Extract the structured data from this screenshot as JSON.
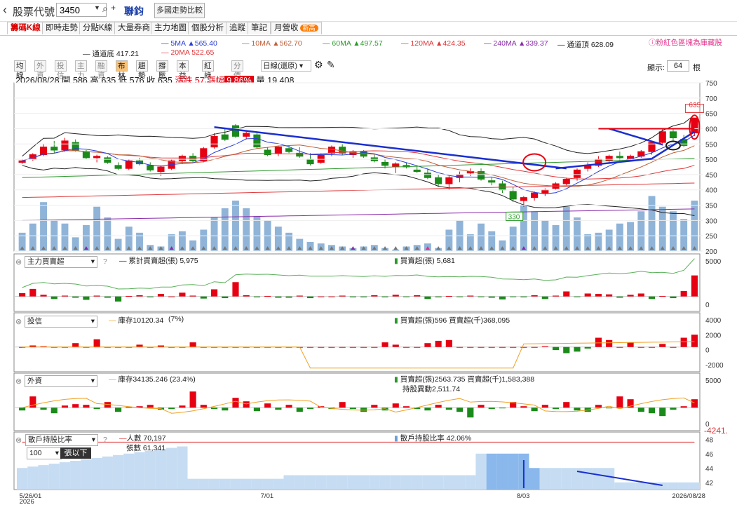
{
  "topbar": {
    "title": "股票代號",
    "stock_code": "3450",
    "stock_name": "聯鈞",
    "compare_label": "多國走勢比較"
  },
  "tabs": [
    {
      "label": "籌碼K線"
    },
    {
      "label": "即時走勢"
    },
    {
      "label": "分點K線"
    },
    {
      "label": "大量券商"
    },
    {
      "label": "主力地圖"
    },
    {
      "label": "個股分析"
    },
    {
      "label": "追蹤"
    },
    {
      "label": "筆記"
    },
    {
      "label": "月營收"
    }
  ],
  "tab_badge": "新高",
  "ma_legend": {
    "ma5": "5MA ▲565.40",
    "ma10": "10MA ▲562.70",
    "ma60": "60MA ▲497.57",
    "ma120": "120MA ▲424.35",
    "ma240": "240MA ▲339.37",
    "upper": "通道頂 628.09",
    "lower": "通道底 417.21",
    "ma20": "20MA 522.65",
    "note": "ⓘ粉紅色區塊為庫藏股"
  },
  "toolbar": {
    "buttons": [
      "均線",
      "外資",
      "投信",
      "主力",
      "融資",
      "布林",
      "趨勢",
      "撐壓",
      "本益比",
      "紅綠燈",
      "分價量"
    ],
    "period": "日線(還原)",
    "display_label": "顯示:",
    "display_count": "64",
    "display_unit": "根"
  },
  "ohlc": {
    "date": "2026/08/28",
    "open": "開 586",
    "high": "高 635",
    "low": "低 576",
    "close": "收 635",
    "change": "漲跌 57",
    "pct_label": "漲幅",
    "pct": "9.86%",
    "volume": "量 19,408"
  },
  "panels": {
    "p1_select": "主力買賣超",
    "p1_cum": "累計買賣超(張) 5,975",
    "p1_net": "買賣超(張) 5,681",
    "p2_select": "投信",
    "p2_inv": "庫存10120.34",
    "p2_pct": "(7%)",
    "p2_net": "買賣超(張)596 買賣超(千)368,095",
    "p3_select": "外資",
    "p3_inv": "庫存34135.246 (23.4%)",
    "p3_net": "買賣超(張)2563.735 買賣超(千)1,583,388",
    "p3_hold": "持股異動2,511.74",
    "p4_select": "散戶持股比率",
    "p4_sub_select": "100",
    "p4_sub_label": "張以下",
    "p4_people": "人數 70,197",
    "p4_shares": "張數 61,341",
    "p4_ratio": "散戶持股比率 42.06%",
    "side_value": "-4241."
  },
  "question_mark": "?",
  "chart_data": {
    "type": "candlestick",
    "price_axis": {
      "ylim": [
        200,
        750
      ],
      "ticks": [
        200,
        250,
        300,
        350,
        400,
        450,
        500,
        550,
        600,
        650,
        700,
        750
      ]
    },
    "candles": [
      [
        490,
        500,
        485,
        495
      ],
      [
        500,
        520,
        495,
        515
      ],
      [
        515,
        550,
        510,
        540
      ],
      [
        540,
        560,
        520,
        530
      ],
      [
        530,
        570,
        525,
        560
      ],
      [
        555,
        565,
        525,
        530
      ],
      [
        525,
        530,
        500,
        505
      ],
      [
        505,
        515,
        490,
        510
      ],
      [
        505,
        510,
        485,
        490
      ],
      [
        480,
        490,
        465,
        470
      ],
      [
        470,
        500,
        465,
        495
      ],
      [
        495,
        505,
        480,
        485
      ],
      [
        480,
        490,
        460,
        465
      ],
      [
        460,
        480,
        445,
        475
      ],
      [
        470,
        500,
        465,
        495
      ],
      [
        495,
        515,
        485,
        510
      ],
      [
        510,
        520,
        490,
        495
      ],
      [
        495,
        540,
        490,
        535
      ],
      [
        540,
        585,
        535,
        575
      ],
      [
        580,
        600,
        560,
        565
      ],
      [
        610,
        615,
        570,
        575
      ],
      [
        575,
        590,
        565,
        585
      ],
      [
        580,
        590,
        535,
        540
      ],
      [
        530,
        540,
        510,
        515
      ],
      [
        520,
        545,
        510,
        540
      ],
      [
        535,
        545,
        520,
        525
      ],
      [
        520,
        540,
        505,
        510
      ],
      [
        500,
        520,
        480,
        485
      ],
      [
        490,
        520,
        485,
        515
      ],
      [
        520,
        545,
        510,
        540
      ],
      [
        540,
        550,
        515,
        520
      ],
      [
        515,
        530,
        505,
        525
      ],
      [
        525,
        530,
        505,
        510
      ],
      [
        505,
        515,
        490,
        495
      ],
      [
        490,
        500,
        470,
        480
      ],
      [
        475,
        490,
        455,
        485
      ],
      [
        480,
        490,
        470,
        475
      ],
      [
        465,
        480,
        455,
        460
      ],
      [
        455,
        470,
        435,
        440
      ],
      [
        440,
        450,
        410,
        420
      ],
      [
        420,
        445,
        400,
        440
      ],
      [
        440,
        460,
        425,
        450
      ],
      [
        455,
        470,
        445,
        460
      ],
      [
        460,
        470,
        430,
        435
      ],
      [
        430,
        440,
        415,
        425
      ],
      [
        420,
        430,
        390,
        400
      ],
      [
        395,
        410,
        360,
        370
      ],
      [
        365,
        380,
        345,
        375
      ],
      [
        375,
        395,
        365,
        390
      ],
      [
        390,
        405,
        380,
        400
      ],
      [
        405,
        425,
        400,
        420
      ],
      [
        420,
        440,
        415,
        435
      ],
      [
        440,
        470,
        430,
        465
      ],
      [
        470,
        490,
        460,
        480
      ],
      [
        480,
        510,
        475,
        500
      ],
      [
        495,
        515,
        490,
        510
      ],
      [
        510,
        525,
        495,
        505
      ],
      [
        500,
        515,
        495,
        510
      ],
      [
        510,
        530,
        505,
        525
      ],
      [
        525,
        560,
        515,
        555
      ],
      [
        555,
        600,
        545,
        590
      ],
      [
        590,
        600,
        560,
        570
      ],
      [
        565,
        580,
        540,
        545
      ],
      [
        586,
        635,
        576,
        635
      ]
    ],
    "volume": [
      260,
      290,
      360,
      300,
      290,
      245,
      285,
      345,
      310,
      240,
      280,
      260,
      220,
      215,
      255,
      265,
      235,
      270,
      310,
      340,
      365,
      340,
      315,
      300,
      280,
      260,
      240,
      230,
      225,
      220,
      215,
      210,
      215,
      220,
      210,
      205,
      215,
      220,
      225,
      210,
      270,
      300,
      255,
      290,
      265,
      235,
      280,
      350,
      330,
      300,
      285,
      345,
      310,
      255,
      260,
      270,
      290,
      295,
      330,
      380,
      345,
      330,
      305,
      365
    ],
    "annotations": [
      {
        "label": "635"
      },
      {
        "label": "330"
      }
    ],
    "x_ticks": [
      {
        "label": "5/26/01"
      },
      {
        "label": "2026"
      },
      {
        "label": "7/01"
      },
      {
        "label": "8/03"
      },
      {
        "label": "2026/08/28"
      }
    ],
    "panel1": {
      "ticks": [
        "5000",
        "0"
      ],
      "values": [
        80,
        180,
        40,
        -60,
        20,
        -30,
        -80,
        20,
        -30,
        -120,
        10,
        30,
        -20,
        60,
        0,
        90,
        20,
        -50,
        170,
        -40,
        340,
        30,
        -20,
        10,
        -30,
        -30,
        20,
        -40,
        0,
        0,
        20,
        -20,
        -20,
        30,
        -20,
        40,
        -10,
        30,
        -60,
        -20,
        10,
        -10,
        20,
        -10,
        -30,
        -70,
        -10,
        -20,
        30,
        -60,
        20,
        120,
        -10,
        70,
        60,
        50,
        -30,
        40,
        70,
        -60,
        10,
        -40,
        130,
        500
      ]
    },
    "panel2": {
      "ticks": [
        "4000",
        "2000",
        "0",
        "-2000"
      ],
      "values": [
        0,
        20,
        10,
        0,
        0,
        50,
        0,
        100,
        0,
        0,
        0,
        30,
        0,
        20,
        0,
        0,
        60,
        0,
        0,
        0,
        0,
        0,
        0,
        0,
        0,
        0,
        0,
        0,
        0,
        0,
        0,
        0,
        0,
        0,
        60,
        30,
        0,
        0,
        50,
        80,
        90,
        0,
        0,
        0,
        0,
        0,
        0,
        0,
        0,
        10,
        -40,
        -80,
        -60,
        -20,
        120,
        90,
        0,
        60,
        0,
        0,
        40,
        0,
        120,
        160,
        110,
        -30,
        160,
        180,
        40,
        -200,
        140,
        80,
        70
      ]
    },
    "panel3": {
      "ticks": [
        "5000",
        "0"
      ],
      "values": [
        -40,
        160,
        -30,
        -80,
        30,
        50,
        40,
        -20,
        80,
        -60,
        10,
        20,
        40,
        -30,
        -20,
        30,
        230,
        40,
        -20,
        -40,
        140,
        90,
        -50,
        60,
        -30,
        40,
        -60,
        -20,
        20,
        -20,
        80,
        -20,
        -60,
        40,
        -40,
        60,
        20,
        -20,
        -40,
        40,
        -30,
        -60,
        -140,
        40,
        -20,
        -10,
        80,
        20,
        -50,
        40,
        -20,
        80,
        -40,
        -60,
        40,
        -10,
        160,
        120,
        -60,
        -80,
        -120,
        -30,
        20,
        120
      ]
    },
    "panel4": {
      "ticks": [
        "48",
        "46",
        "44",
        "42"
      ]
    }
  }
}
